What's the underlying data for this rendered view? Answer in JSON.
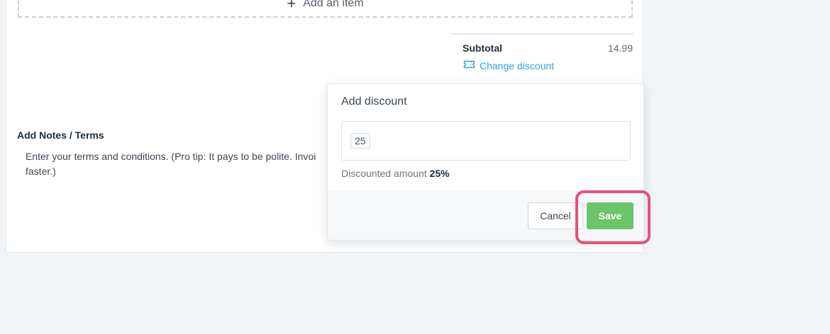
{
  "invoice": {
    "add_item_label": "Add an item",
    "subtotal_label": "Subtotal",
    "subtotal_value": "14.99",
    "change_discount_label": "Change discount",
    "notes_title": "Add Notes / Terms",
    "notes_text_line1": "Enter your terms and conditions. (Pro tip: It pays to be polite. Invoi",
    "notes_text_line2": "faster.)"
  },
  "discount_popover": {
    "title": "Add discount",
    "input_value": "25",
    "discounted_amount_label": "Discounted amount",
    "discounted_amount_value": "25%",
    "cancel_label": "Cancel",
    "save_label": "Save"
  },
  "icons": {
    "add_item": "plus-icon",
    "change_discount": "ticket-icon"
  },
  "colors": {
    "link": "#2aa7d9",
    "save_button": "#6cc46b",
    "highlight": "#e74f7a",
    "page_background": "#f0f4f7"
  }
}
